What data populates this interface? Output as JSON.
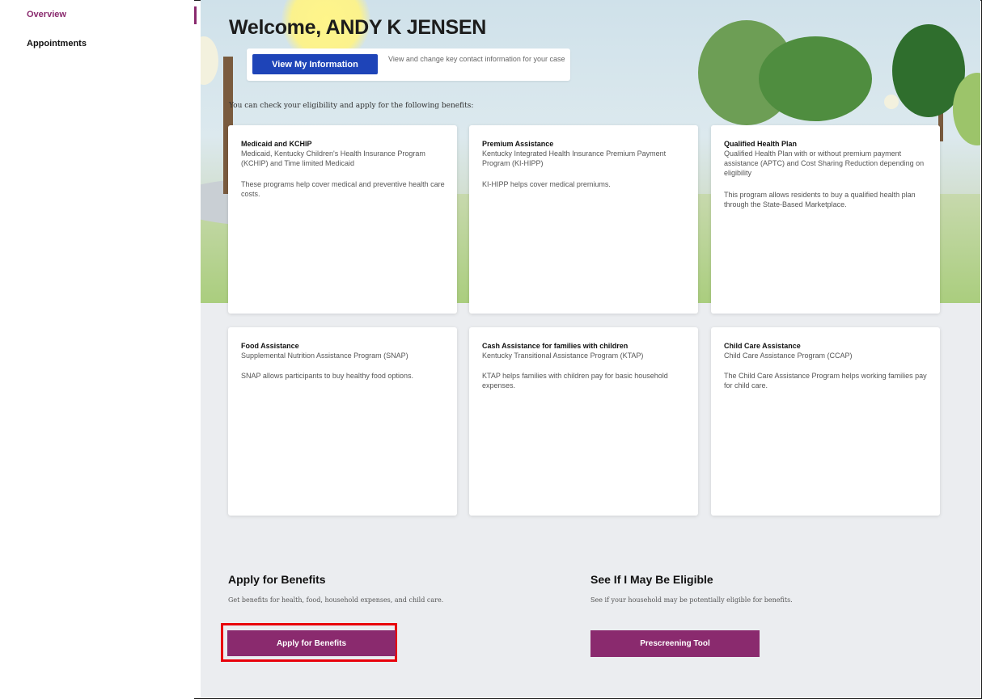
{
  "sidebar": {
    "items": [
      {
        "label": "Overview",
        "active": true
      },
      {
        "label": "Appointments",
        "active": false
      }
    ]
  },
  "hero": {
    "welcome": "Welcome, ANDY K JENSEN",
    "view_info_button": "View My Information",
    "view_info_desc": "View and change key contact information for your case",
    "eligibility_text": "You can check your eligibility and apply for the following benefits:"
  },
  "cards": [
    {
      "title": "Medicaid and KCHIP",
      "subtitle": "Medicaid, Kentucky Children's Health Insurance Program (KCHIP) and Time limited Medicaid",
      "description": "These programs help cover medical and preventive health care costs."
    },
    {
      "title": "Premium Assistance",
      "subtitle": "Kentucky Integrated Health Insurance Premium Payment Program (KI-HIPP)",
      "description": "KI-HIPP helps cover medical premiums."
    },
    {
      "title": "Qualified Health Plan",
      "subtitle": "Qualified Health Plan with or without premium payment assistance (APTC) and Cost Sharing Reduction depending on eligibility",
      "description": "This program allows residents to buy a qualified health plan through the State-Based Marketplace."
    },
    {
      "title": "Food Assistance",
      "subtitle": "Supplemental Nutrition Assistance Program (SNAP)",
      "description": "SNAP allows participants to buy healthy food options."
    },
    {
      "title": "Cash Assistance for families with children",
      "subtitle": "Kentucky Transitional Assistance Program (KTAP)",
      "description": "KTAP helps families with children pay for basic household expenses."
    },
    {
      "title": "Child Care Assistance",
      "subtitle": "Child Care Assistance Program (CCAP)",
      "description": "The Child Care Assistance Program helps working families pay for child care."
    }
  ],
  "apply": {
    "title": "Apply for Benefits",
    "description": "Get benefits for health, food, household expenses, and child care.",
    "button": "Apply for Benefits"
  },
  "eligible": {
    "title": "See If I May Be Eligible",
    "description": "See if your household may be potentially eligible for benefits.",
    "button": "Prescreening Tool"
  },
  "colors": {
    "accent_purple": "#8a2a6e",
    "button_blue": "#1e44b8",
    "highlight_red": "#e8000b"
  }
}
